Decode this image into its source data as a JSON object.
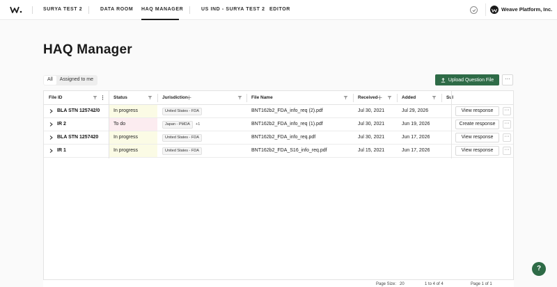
{
  "nav": {
    "items": [
      "SURYA TEST 2",
      "DATA ROOM",
      "HAQ MANAGER",
      "US IND - SURYA TEST 2",
      "EDITOR"
    ],
    "org_name": "Weave Platform, Inc."
  },
  "page": {
    "title": "HAQ Manager"
  },
  "filters": {
    "all": "All",
    "assigned": "Assigned to me"
  },
  "toolbar": {
    "upload_label": "Upload Question File",
    "more": "···"
  },
  "table": {
    "columns": [
      "File ID",
      "Status",
      "Jurisdiction",
      "File Name",
      "Received",
      "Added",
      "Sul"
    ],
    "rows": [
      {
        "file_id": "BLA STN 125742/0",
        "status": "In progress",
        "jurisdiction": "United States - FDA",
        "extra": "",
        "file_name": "BNT162b2_FDA_info_req (2).pdf",
        "received": "Jul 30, 2021",
        "added": "Jul 29, 2026",
        "action": "View response"
      },
      {
        "file_id": "IR 2",
        "status": "To do",
        "jurisdiction": "Japan - PMDA",
        "extra": "+1",
        "file_name": "BNT162b2_FDA_info_req (1).pdf",
        "received": "Jul 30, 2021",
        "added": "Jun 19, 2026",
        "action": "Create response"
      },
      {
        "file_id": "BLA STN 1257420",
        "status": "In progress",
        "jurisdiction": "United States - FDA",
        "extra": "",
        "file_name": "BNT162b2_FDA_info_req.pdf",
        "received": "Jul 30, 2021",
        "added": "Jun 17, 2026",
        "action": "View response"
      },
      {
        "file_id": "IR 1",
        "status": "In progress",
        "jurisdiction": "United States - FDA",
        "extra": "",
        "file_name": "BNT162b2_FDA_S16_info_req.pdf",
        "received": "Jul 15, 2021",
        "added": "Jun 17, 2026",
        "action": "View response"
      }
    ],
    "more": "···"
  },
  "footer": {
    "page_size_label": "Page Size:",
    "page_size": "20",
    "range": "1 to 4 of 4",
    "page": "Page 1 of 1"
  },
  "help": "?",
  "colors": {
    "accent": "#2e6b47",
    "in_progress": "#fbfbe5",
    "to_do": "#fcecf0"
  }
}
